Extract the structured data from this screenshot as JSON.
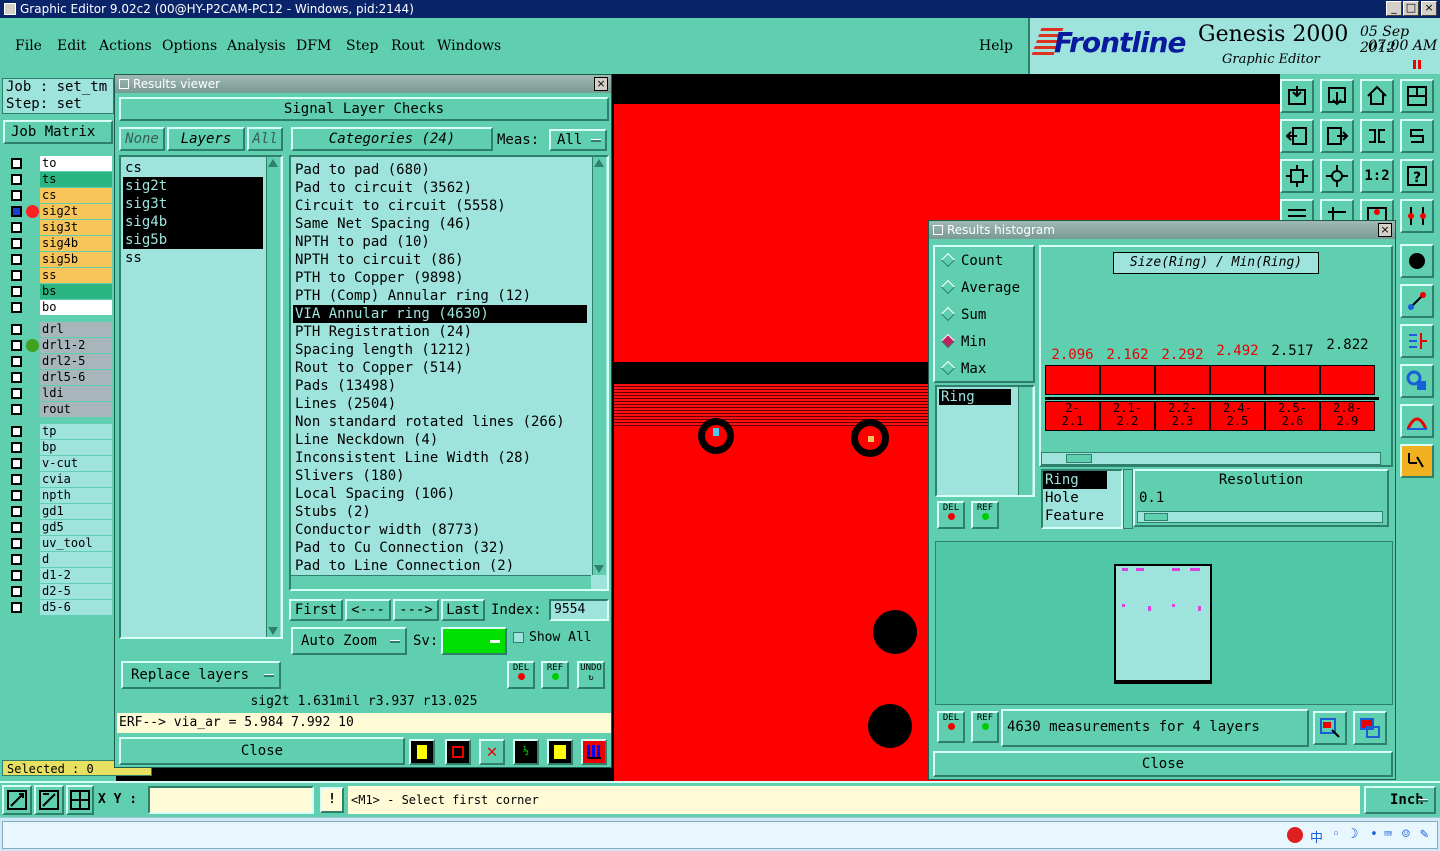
{
  "window": {
    "title": "Graphic Editor 9.02c2 (00@HY-P2CAM-PC12 - Windows, pid:2144)",
    "min": "_",
    "max": "□",
    "close": "×"
  },
  "menu": [
    "File",
    "Edit",
    "Actions",
    "Options",
    "Analysis",
    "DFM",
    "Step",
    "Rout",
    "Windows"
  ],
  "help": "Help",
  "brand": {
    "logo": "Frontline",
    "product": "Genesis 2000",
    "subtitle": "Graphic Editor",
    "date": "05 Sep 2012",
    "time": "07:00 AM"
  },
  "job": {
    "job_label": "Job : set_tm",
    "step_label": "Step: set",
    "matrix_button": "Job Matrix",
    "selected": "Selected : 0"
  },
  "layers": [
    {
      "name": "to",
      "color": "#ffffff"
    },
    {
      "name": "ts",
      "color": "#2bb582"
    },
    {
      "name": "cs",
      "color": "#f8c55a"
    },
    {
      "name": "sig2t",
      "color": "#f8c55a"
    },
    {
      "name": "sig3t",
      "color": "#f8c55a"
    },
    {
      "name": "sig4b",
      "color": "#f8c55a"
    },
    {
      "name": "sig5b",
      "color": "#f8c55a"
    },
    {
      "name": "ss",
      "color": "#f8c55a"
    },
    {
      "name": "bs",
      "color": "#2bb582"
    },
    {
      "name": "bo",
      "color": "#ffffff"
    },
    {
      "name": "drl",
      "color": "#a7b6bb"
    },
    {
      "name": "drl1-2",
      "color": "#a7b6bb"
    },
    {
      "name": "drl2-5",
      "color": "#a7b6bb"
    },
    {
      "name": "drl5-6",
      "color": "#a7b6bb"
    },
    {
      "name": "ldi",
      "color": "#a7b6bb"
    },
    {
      "name": "rout",
      "color": "#a7b6bb"
    },
    {
      "name": "tp",
      "color": "#9fe3dd"
    },
    {
      "name": "bp",
      "color": "#9fe3dd"
    },
    {
      "name": "v-cut",
      "color": "#9fe3dd"
    },
    {
      "name": "cvia",
      "color": "#9fe3dd"
    },
    {
      "name": "npth",
      "color": "#9fe3dd"
    },
    {
      "name": "gd1",
      "color": "#9fe3dd"
    },
    {
      "name": "gd5",
      "color": "#9fe3dd"
    },
    {
      "name": "uv_tool",
      "color": "#9fe3dd"
    },
    {
      "name": "d",
      "color": "#9fe3dd"
    },
    {
      "name": "d1-2",
      "color": "#9fe3dd"
    },
    {
      "name": "d2-5",
      "color": "#9fe3dd"
    },
    {
      "name": "d5-6",
      "color": "#9fe3dd"
    }
  ],
  "results_viewer": {
    "title": "Results viewer",
    "header": "Signal Layer Checks",
    "none_btn": "None",
    "layers_btn": "Layers",
    "all_btn": "All",
    "categories_btn": "Categories (24)",
    "meas_label": "Meas:",
    "meas_value": "All",
    "layer_list": [
      {
        "name": "cs",
        "selected": false
      },
      {
        "name": "sig2t",
        "selected": true
      },
      {
        "name": "sig3t",
        "selected": true
      },
      {
        "name": "sig4b",
        "selected": true
      },
      {
        "name": "sig5b",
        "selected": true
      },
      {
        "name": "ss",
        "selected": false
      }
    ],
    "categories": [
      {
        "name": "Pad to pad (680)",
        "selected": false
      },
      {
        "name": "Pad to circuit (3562)",
        "selected": false
      },
      {
        "name": "Circuit to circuit (5558)",
        "selected": false
      },
      {
        "name": "Same Net Spacing (46)",
        "selected": false
      },
      {
        "name": "NPTH to pad (10)",
        "selected": false
      },
      {
        "name": "NPTH to circuit (86)",
        "selected": false
      },
      {
        "name": "PTH to Copper (9898)",
        "selected": false
      },
      {
        "name": "PTH (Comp) Annular ring (12)",
        "selected": false
      },
      {
        "name": "VIA Annular ring (4630)",
        "selected": true
      },
      {
        "name": "PTH Registration (24)",
        "selected": false
      },
      {
        "name": "Spacing length (1212)",
        "selected": false
      },
      {
        "name": "Rout to Copper (514)",
        "selected": false
      },
      {
        "name": "Pads (13498)",
        "selected": false
      },
      {
        "name": "Lines (2504)",
        "selected": false
      },
      {
        "name": "Non standard rotated lines (266)",
        "selected": false
      },
      {
        "name": "Line Neckdown (4)",
        "selected": false
      },
      {
        "name": "Inconsistent Line Width (28)",
        "selected": false
      },
      {
        "name": "Slivers (180)",
        "selected": false
      },
      {
        "name": "Local Spacing (106)",
        "selected": false
      },
      {
        "name": "Stubs (2)",
        "selected": false
      },
      {
        "name": "Conductor width (8773)",
        "selected": false
      },
      {
        "name": "Pad to Cu Connection (32)",
        "selected": false
      },
      {
        "name": "Pad to Line Connection (2)",
        "selected": false
      }
    ],
    "nav": {
      "first": "First",
      "prev": "<---",
      "next": "--->",
      "last": "Last",
      "index_label": "Index:",
      "index_value": "9554"
    },
    "auto_zoom": "Auto Zoom",
    "sv_label": "Sv:",
    "show_all": "Show All",
    "replace_layers": "Replace layers",
    "del": "DEL",
    "ref": "REF",
    "undo": "UNDO",
    "status": "sig2t 1.631mil  r3.937  r13.025",
    "erf": "ERF--> via_ar = 5.984 7.992 10",
    "close": "Close"
  },
  "histogram": {
    "title": "Results histogram",
    "radio": [
      {
        "label": "Count",
        "checked": false
      },
      {
        "label": "Average",
        "checked": false
      },
      {
        "label": "Sum",
        "checked": false
      },
      {
        "label": "Min",
        "checked": true
      },
      {
        "label": "Max",
        "checked": false
      }
    ],
    "chart_title": "Size(Ring) / Min(Ring)",
    "bars": [
      {
        "value": "2.096",
        "range": "2-\n2.1",
        "red": true
      },
      {
        "value": "2.162",
        "range": "2.1-\n2.2",
        "red": true
      },
      {
        "value": "2.292",
        "range": "2.2-\n2.3",
        "red": true
      },
      {
        "value": "2.492",
        "range": "2.4-\n2.5",
        "red": true
      },
      {
        "value": "2.517",
        "range": "2.5-\n2.6",
        "red": false
      },
      {
        "value": "2.822",
        "range": "2.8-\n2.9",
        "red": false
      }
    ],
    "ring_list": "Ring",
    "types": [
      "Ring",
      "Hole",
      "Feature"
    ],
    "resolution_label": "Resolution",
    "resolution_value": "0.1",
    "summary": "4630 measurements for 4 layers",
    "close": "Close"
  },
  "bottom": {
    "xy_label": "X Y :",
    "xy_value": "",
    "bang": "!",
    "prompt": "<M1> - Select first corner",
    "units": "Inch"
  },
  "colors": {
    "teal": "#5fcfb0",
    "light_teal": "#9fe3dd",
    "board_red": "#ff0000"
  }
}
